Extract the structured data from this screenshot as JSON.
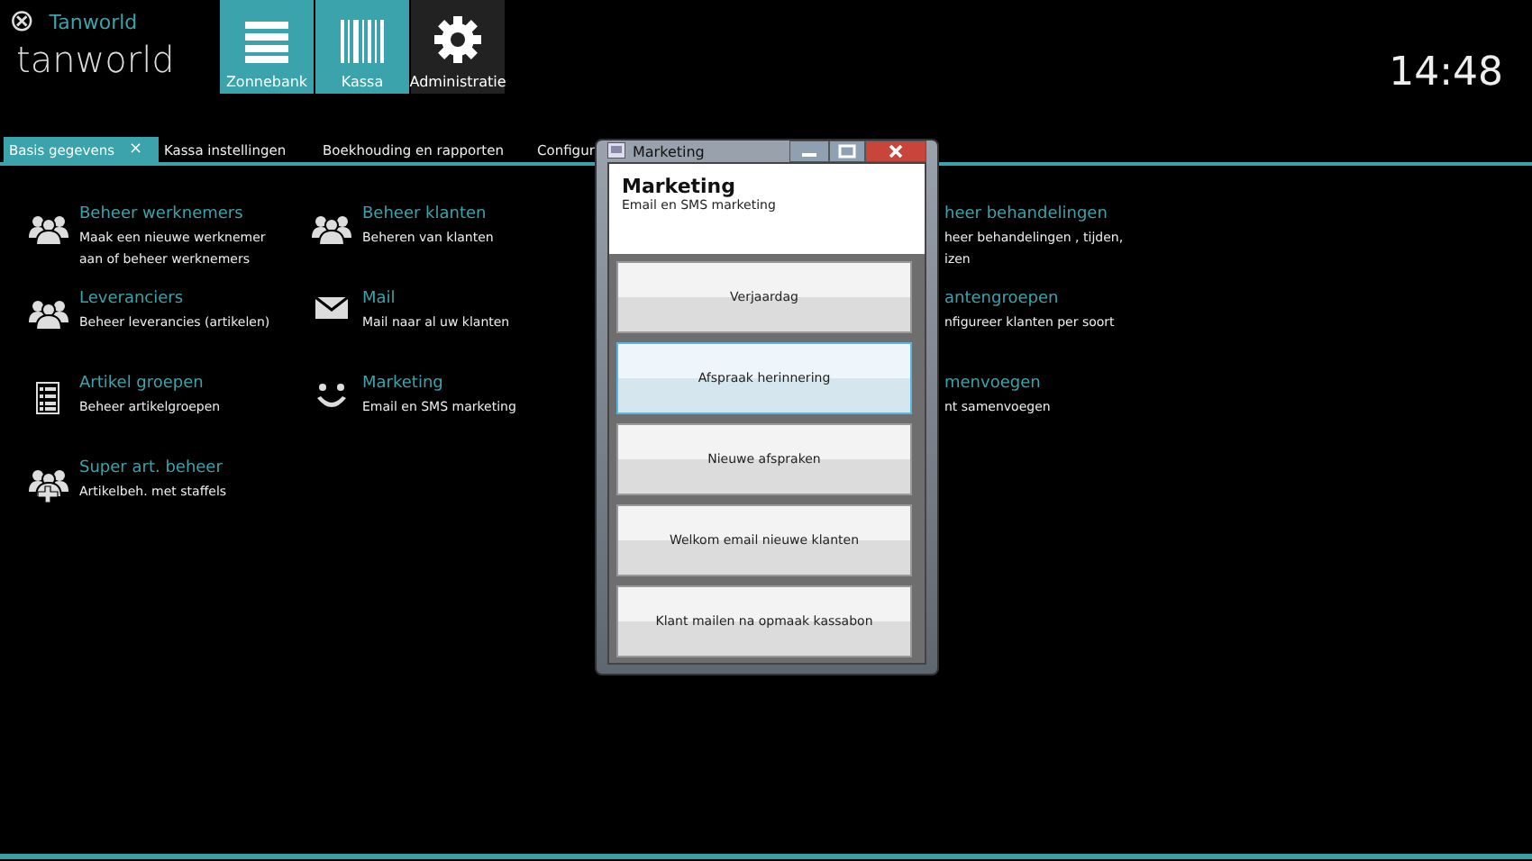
{
  "app": {
    "close_icon": "⊗",
    "name": "Tanworld",
    "title": "tanworld",
    "clock": "14:48"
  },
  "tiles": [
    {
      "kind": "menu",
      "label": "Zonnebank",
      "selected": true
    },
    {
      "kind": "barcode",
      "label": "Kassa",
      "selected": true
    },
    {
      "kind": "gear",
      "label": "Administratie",
      "selected": false
    }
  ],
  "tabs": [
    {
      "label": "Basis gegevens",
      "close": "×",
      "selected": true
    },
    {
      "label": "Kassa instellingen",
      "selected": false
    },
    {
      "label": "Boekhouding en rapporten",
      "selected": false
    },
    {
      "label": "Configur",
      "selected": false
    }
  ],
  "items": [
    {
      "kind": "people",
      "title": "Beheer werknemers",
      "description": [
        "Maak een nieuwe werknemer",
        "aan of beheer werknemers"
      ]
    },
    {
      "kind": "people",
      "title": "Beheer klanten",
      "description": [
        "Beheren van klanten"
      ]
    },
    {
      "kind": "none",
      "title": "heer behandelingen",
      "description": [
        "heer behandelingen , tijden,",
        "izen"
      ]
    },
    {
      "kind": "people",
      "title": "Leveranciers",
      "description": [
        "Beheer leverancies (artikelen)"
      ]
    },
    {
      "kind": "mail",
      "title": "Mail",
      "description": [
        "Mail naar al uw klanten"
      ]
    },
    {
      "kind": "none",
      "title": "antengroepen",
      "description": [
        "nfigureer klanten per soort"
      ]
    },
    {
      "kind": "list",
      "title": "Artikel groepen",
      "description": [
        "Beheer artikelgroepen"
      ]
    },
    {
      "kind": "smile",
      "title": "Marketing",
      "description": [
        "Email en SMS marketing"
      ]
    },
    {
      "kind": "none",
      "title": "menvoegen",
      "description": [
        "nt samenvoegen"
      ]
    },
    {
      "kind": "people-plus",
      "title": "Super art. beheer",
      "description": [
        "Artikelbeh. met staffels"
      ]
    }
  ],
  "dialog": {
    "title": "Marketing",
    "heading": "Marketing",
    "subheading": "Email en SMS marketing",
    "buttons": [
      {
        "label": "Verjaardag",
        "focused": false
      },
      {
        "label": "Afspraak herinnering",
        "focused": true
      },
      {
        "label": "Nieuwe afspraken",
        "focused": false
      },
      {
        "label": "Welkom email nieuwe klanten",
        "focused": false
      },
      {
        "label": "Klant mailen na opmaak kassabon",
        "focused": false
      }
    ]
  }
}
